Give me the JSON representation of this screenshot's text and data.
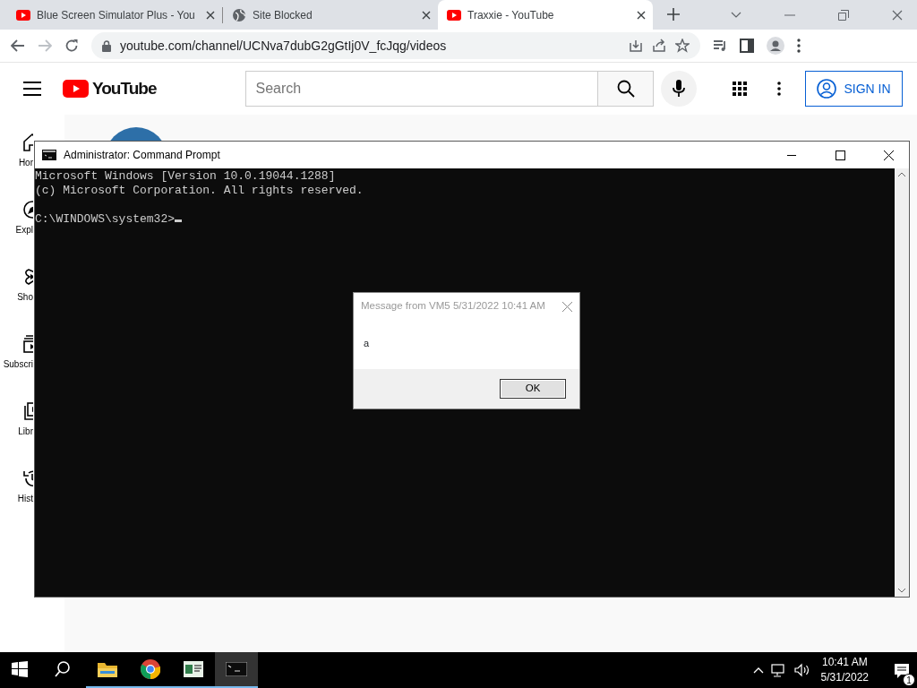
{
  "browser": {
    "tabs": [
      {
        "title": "Blue Screen Simulator Plus - You",
        "kind": "video",
        "selected": false
      },
      {
        "title": "Site Blocked",
        "kind": "globe",
        "selected": false
      },
      {
        "title": "Traxxie - YouTube",
        "kind": "video",
        "selected": true
      }
    ],
    "address": "youtube.com/channel/UCNva7dubG2gGtIj0V_fcJqg/videos"
  },
  "youtube": {
    "logo": "YouTube",
    "search": {
      "placeholder": "Search"
    },
    "sign_in": "SIGN IN",
    "sidebar": [
      {
        "label": "Hor",
        "kind": "home"
      },
      {
        "label": "Expl",
        "kind": "explore"
      },
      {
        "label": "Sho",
        "kind": "shorts"
      },
      {
        "label": "Subscri",
        "kind": "subscriptions"
      },
      {
        "label": "Libr",
        "kind": "library"
      },
      {
        "label": "Hist",
        "kind": "history"
      }
    ]
  },
  "cmd": {
    "title": "Administrator: Command Prompt",
    "output": [
      "Microsoft Windows [Version 10.0.19044.1288]",
      "(c) Microsoft Corporation. All rights reserved."
    ],
    "prompt": "C:\\WINDOWS\\system32>"
  },
  "message_box": {
    "title": "Message from VM5 5/31/2022 10:41 AM",
    "text": "a",
    "button": "OK"
  },
  "taskbar": {
    "buttons": [
      {
        "kind": "start",
        "running": false,
        "selected": false
      },
      {
        "kind": "search",
        "running": false,
        "selected": false
      },
      {
        "kind": "folder",
        "running": true,
        "selected": false
      },
      {
        "kind": "chrome",
        "running": true,
        "selected": false
      },
      {
        "kind": "app",
        "running": true,
        "selected": false
      },
      {
        "kind": "console",
        "running": true,
        "selected": true
      }
    ],
    "time": "10:41 AM",
    "date": "5/31/2022",
    "notifications": "1"
  }
}
